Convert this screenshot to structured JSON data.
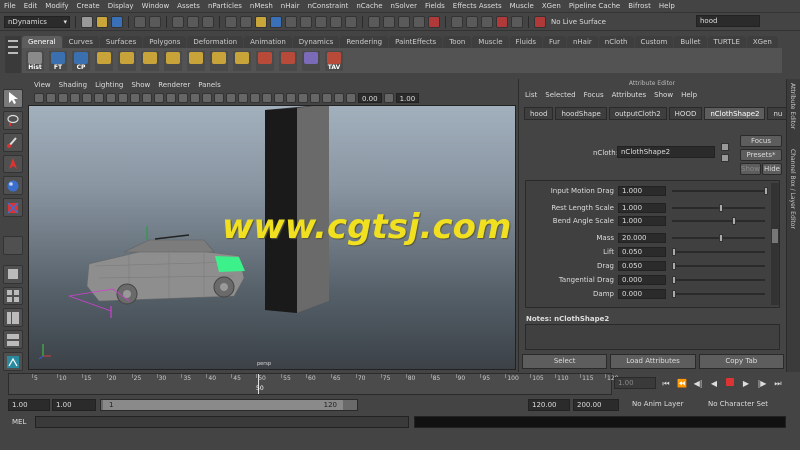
{
  "menubar": [
    "File",
    "Edit",
    "Modify",
    "Create",
    "Display",
    "Window",
    "Assets",
    "nParticles",
    "nMesh",
    "nHair",
    "nConstraint",
    "nCache",
    "nSolver",
    "Fields",
    "Effects Assets",
    "Muscle",
    "XGen",
    "Pipeline Cache",
    "Bifrost",
    "Help"
  ],
  "status_line": {
    "menu_set": "nDynamics",
    "live_surface": "No Live Surface",
    "search_value": "hood"
  },
  "shelf": {
    "tabs": [
      "General",
      "Curves",
      "Surfaces",
      "Polygons",
      "Deformation",
      "Animation",
      "Dynamics",
      "Rendering",
      "PaintEffects",
      "Toon",
      "Muscle",
      "Fluids",
      "Fur",
      "nHair",
      "nCloth",
      "Custom",
      "Bullet",
      "TURTLE",
      "XGen"
    ],
    "active_tab": "General",
    "icons": [
      {
        "label": "Hist",
        "color": "#8a8a8a"
      },
      {
        "label": "FT",
        "color": "#3a6fb0"
      },
      {
        "label": "CP",
        "color": "#3a6fb0"
      },
      {
        "label": "",
        "color": "#c8a33a"
      },
      {
        "label": "",
        "color": "#c8a33a"
      },
      {
        "label": "",
        "color": "#c8a33a"
      },
      {
        "label": "",
        "color": "#c8a33a"
      },
      {
        "label": "",
        "color": "#c8a33a"
      },
      {
        "label": "",
        "color": "#c8a33a"
      },
      {
        "label": "",
        "color": "#c8a33a"
      },
      {
        "label": "",
        "color": "#b84a3a"
      },
      {
        "label": "",
        "color": "#b84a3a"
      },
      {
        "label": "",
        "color": "#7a6ab8"
      },
      {
        "label": "TAV",
        "color": "#b84a3a"
      }
    ]
  },
  "viewport": {
    "menu": [
      "View",
      "Shading",
      "Lighting",
      "Show",
      "Renderer",
      "Panels"
    ],
    "field_1": "0.00",
    "field_2": "1.00",
    "camera_label": "persp"
  },
  "watermark": "www.cgtsj.com",
  "attribute_editor": {
    "title": "Attribute Editor",
    "menu": [
      "List",
      "Selected",
      "Focus",
      "Attributes",
      "Show",
      "Help"
    ],
    "tabs": [
      "hood",
      "hoodShape",
      "outputCloth2",
      "HOOD",
      "nClothShape2",
      "nu"
    ],
    "active_tab": "nClothShape2",
    "node_label": "nCloth:",
    "node_value": "nClothShape2",
    "focus_btn": "Focus",
    "presets_btn": "Presets*",
    "show_btn": "Show",
    "hide_btn": "Hide",
    "attributes": [
      {
        "label": "Input Motion Drag",
        "value": "1.000",
        "slider": 0.99
      },
      {
        "label": "Rest Length Scale",
        "value": "1.000",
        "slider": 0.5
      },
      {
        "label": "Bend Angle Scale",
        "value": "1.000",
        "slider": 0.65
      },
      {
        "label": "Mass",
        "value": "20.000",
        "slider": 0.5
      },
      {
        "label": "Lift",
        "value": "0.050",
        "slider": 0.0
      },
      {
        "label": "Drag",
        "value": "0.050",
        "slider": 0.0
      },
      {
        "label": "Tangential Drag",
        "value": "0.000",
        "slider": 0.0
      },
      {
        "label": "Damp",
        "value": "0.000",
        "slider": 0.0
      }
    ],
    "notes_label": "Notes:  nClothShape2",
    "bottom_buttons": [
      "Select",
      "Load Attributes",
      "Copy Tab"
    ]
  },
  "side_tabs": [
    "Attribute Editor",
    "Channel Box / Layer Editor"
  ],
  "timeline": {
    "ticks": [
      "5",
      "10",
      "15",
      "20",
      "25",
      "30",
      "35",
      "40",
      "45",
      "50",
      "55",
      "60",
      "65",
      "70",
      "75",
      "80",
      "85",
      "90",
      "95",
      "100",
      "105",
      "110",
      "115",
      "120"
    ],
    "current_frame": "50",
    "current_frame_field": "1.00"
  },
  "range": {
    "start_field": "1.00",
    "current_field": "1.00",
    "range_start": "1",
    "range_end": "120",
    "end_field": "120.00",
    "anim_end_field": "200.00",
    "anim_layer": "No Anim Layer",
    "character_set": "No Character Set"
  },
  "command_line": {
    "label": "MEL"
  }
}
